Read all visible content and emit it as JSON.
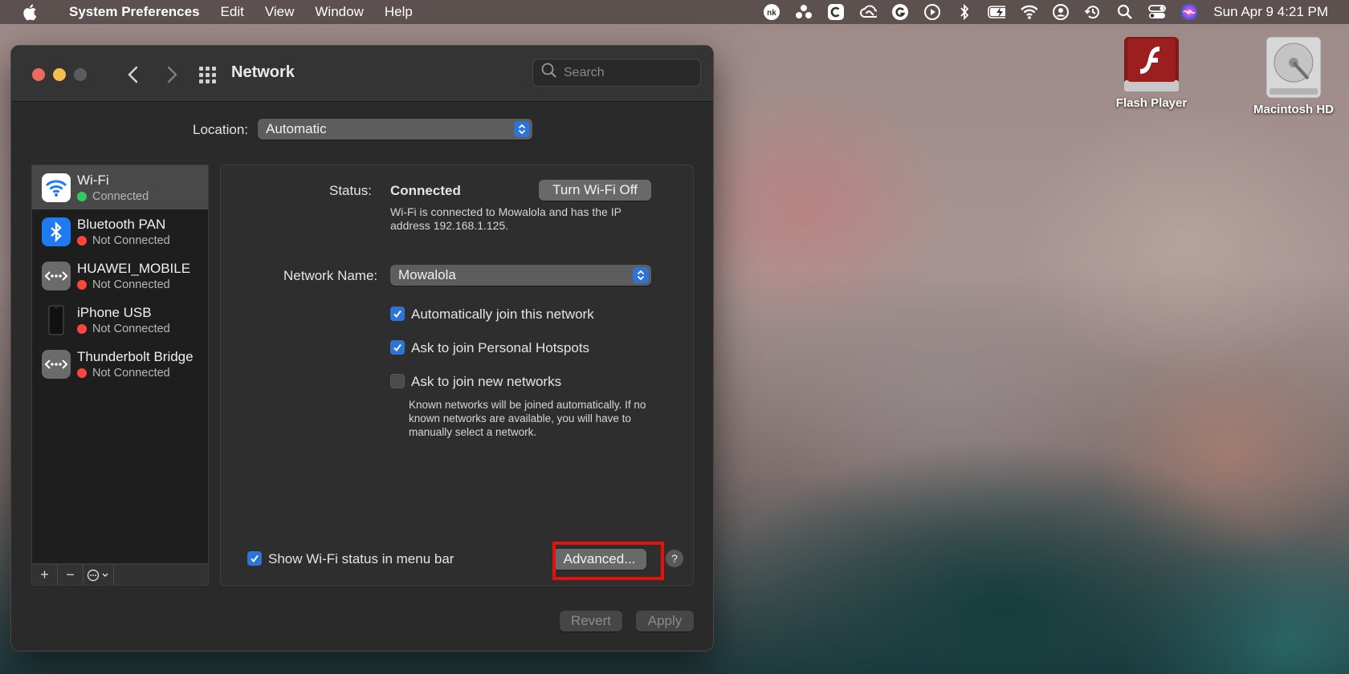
{
  "menubar": {
    "app_name": "System Preferences",
    "menus": [
      "Edit",
      "View",
      "Window",
      "Help"
    ],
    "clock": "Sun Apr 9  4:21 PM",
    "status_icons": [
      "nk-icon",
      "cluster-icon",
      "c-icon",
      "creative-cloud-icon",
      "grammarly-icon",
      "play-icon",
      "bluetooth-icon",
      "battery-icon",
      "wifi-icon",
      "user-icon",
      "time-machine-icon",
      "search-icon",
      "control-center-icon",
      "siri-icon"
    ]
  },
  "window": {
    "title": "Network",
    "search_placeholder": "Search",
    "location_label": "Location:",
    "location_value": "Automatic"
  },
  "services": [
    {
      "name": "Wi-Fi",
      "status": "Connected",
      "status_color": "#34c759",
      "icon": "wifi-icon",
      "selected": true
    },
    {
      "name": "Bluetooth PAN",
      "status": "Not Connected",
      "status_color": "#ff453a",
      "icon": "bluetooth-icon",
      "selected": false
    },
    {
      "name": "HUAWEI_MOBILE",
      "status": "Not Connected",
      "status_color": "#ff453a",
      "icon": "ethernet-dots-icon",
      "selected": false
    },
    {
      "name": "iPhone USB",
      "status": "Not Connected",
      "status_color": "#ff453a",
      "icon": "iphone-icon",
      "selected": false
    },
    {
      "name": "Thunderbolt Bridge",
      "status": "Not Connected",
      "status_color": "#ff453a",
      "icon": "ethernet-dots-icon",
      "selected": false
    }
  ],
  "sidebar_tools": [
    "+",
    "−"
  ],
  "detail": {
    "status_label": "Status:",
    "status_value": "Connected",
    "turn_off_button": "Turn Wi-Fi Off",
    "status_note": "Wi-Fi is connected to Mowalola and has the IP address 192.168.1.125.",
    "network_name_label": "Network Name:",
    "network_name_value": "Mowalola",
    "checkboxes": [
      {
        "label": "Automatically join this network",
        "checked": true
      },
      {
        "label": "Ask to join Personal Hotspots",
        "checked": true
      },
      {
        "label": "Ask to join new networks",
        "checked": false
      }
    ],
    "join_note": "Known networks will be joined automatically. If no known networks are available, you will have to manually select a network.",
    "show_status_label": "Show Wi-Fi status in menu bar",
    "show_status_checked": true,
    "advanced_button": "Advanced...",
    "help_button": "?"
  },
  "footer": {
    "revert_button": "Revert",
    "apply_button": "Apply"
  },
  "desktop": [
    {
      "label": "Flash Player",
      "icon": "flash-player-icon"
    },
    {
      "label": "Macintosh HD",
      "icon": "hard-drive-icon"
    }
  ]
}
